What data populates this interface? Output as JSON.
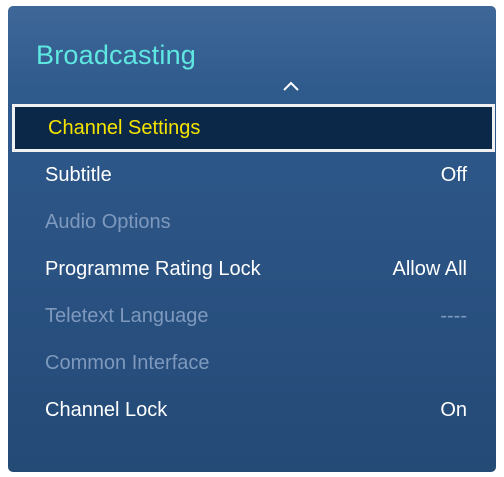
{
  "menu": {
    "title": "Broadcasting",
    "scroll_up_icon": "chevron-up-icon",
    "colors": {
      "title": "#5fe8e1",
      "focus_text": "#f4e400",
      "enabled_text": "#ffffff",
      "disabled_text": "#7e99bd",
      "panel": "#2c5586",
      "focus_bg": "#0c2849"
    },
    "items": [
      {
        "label": "Channel Settings",
        "value": "",
        "state": "focused"
      },
      {
        "label": "Subtitle",
        "value": "Off",
        "state": "enabled"
      },
      {
        "label": "Audio Options",
        "value": "",
        "state": "disabled"
      },
      {
        "label": "Programme Rating Lock",
        "value": "Allow All",
        "state": "enabled"
      },
      {
        "label": "Teletext Language",
        "value": "----",
        "state": "disabled"
      },
      {
        "label": "Common Interface",
        "value": "",
        "state": "disabled"
      },
      {
        "label": "Channel Lock",
        "value": "On",
        "state": "enabled"
      }
    ]
  }
}
